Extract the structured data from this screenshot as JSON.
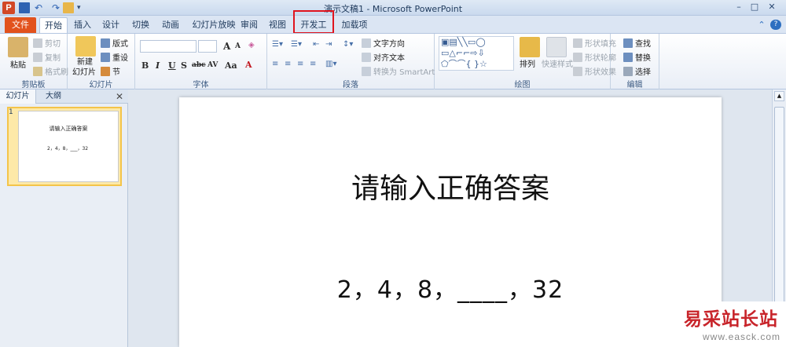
{
  "window": {
    "title": "演示文稿1 - Microsoft PowerPoint",
    "app_icon_letter": "P"
  },
  "tabs": {
    "file": "文件",
    "items": [
      "开始",
      "插入",
      "设计",
      "切换",
      "动画",
      "幻灯片放映",
      "审阅",
      "视图",
      "开发工具",
      "加载项"
    ],
    "active": "开始",
    "highlighted": "开发工具"
  },
  "ribbon": {
    "clipboard": {
      "label": "剪贴板",
      "paste": "粘贴",
      "cut": "剪切",
      "copy": "复制",
      "format_painter": "格式刷"
    },
    "slides": {
      "label": "幻灯片",
      "new_slide_1": "新建",
      "new_slide_2": "幻灯片",
      "layout": "版式",
      "reset": "重设",
      "section": "节"
    },
    "font": {
      "label": "字体",
      "bold": "B",
      "italic": "I",
      "underline": "U",
      "shadow": "S",
      "strike": "abc",
      "spacing": "AV",
      "case": "Aa",
      "grow": "A",
      "shrink": "A"
    },
    "paragraph": {
      "label": "段落",
      "text_direction": "文字方向",
      "align_text": "对齐文本",
      "smartart": "转换为 SmartArt"
    },
    "drawing": {
      "label": "绘图",
      "arrange": "排列",
      "quick_styles": "快速样式",
      "shape_fill": "形状填充",
      "shape_outline": "形状轮廓",
      "shape_effects": "形状效果"
    },
    "editing": {
      "label": "编辑",
      "find": "查找",
      "replace": "替换",
      "select": "选择"
    }
  },
  "panel": {
    "tabs": [
      "幻灯片",
      "大纲"
    ],
    "close": "✕",
    "thumb_number": "1",
    "thumb_title": "请输入正确答案",
    "thumb_body": "2，4，8，___，32"
  },
  "slide": {
    "title": "请输入正确答案",
    "body": "2，4，8，____，32"
  },
  "watermark": {
    "text": "易采站长站",
    "url": "www.easck.com"
  },
  "colors": {
    "file_tab": "#e2521d",
    "highlight_border": "#e0141e",
    "ribbon_bg": "#ffffff",
    "thumb_selected": "#f4c449"
  }
}
